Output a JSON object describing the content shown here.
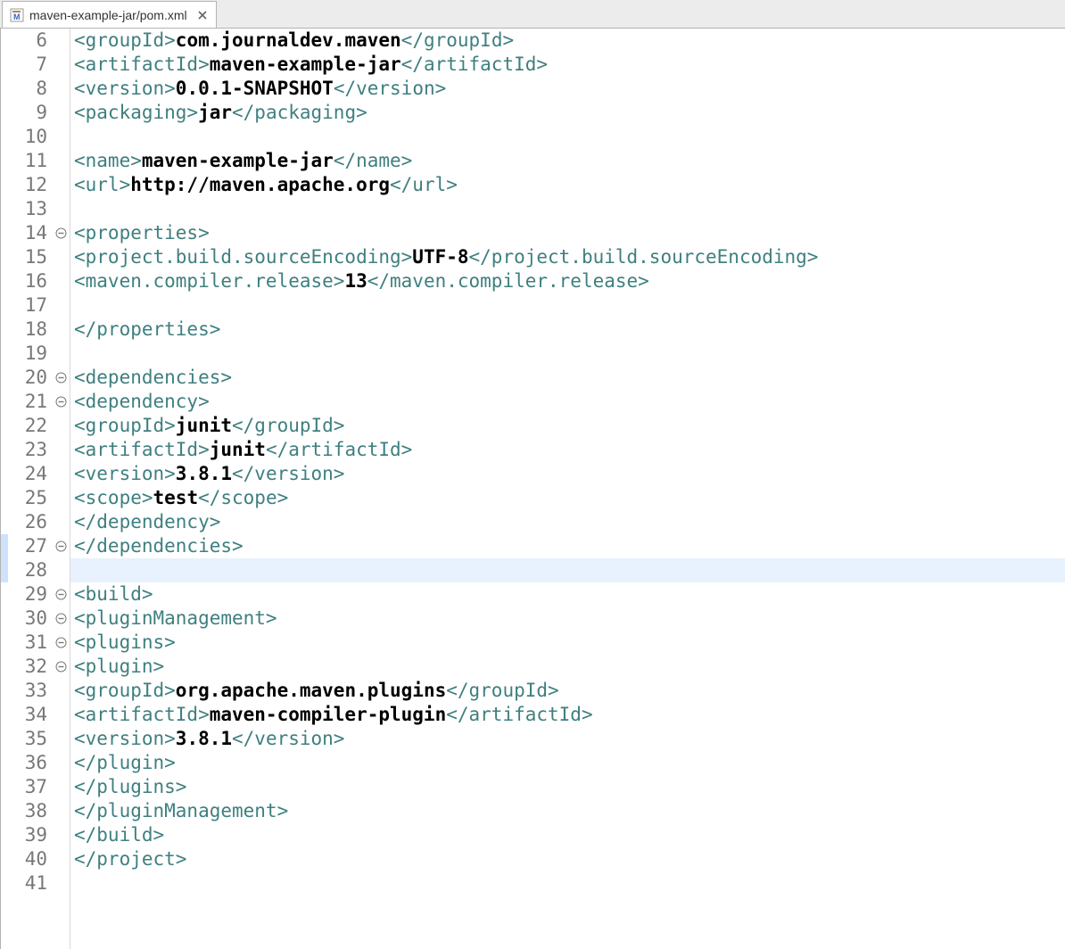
{
  "tab": {
    "title": "maven-example-jar/pom.xml"
  },
  "editor": {
    "highlighted_lines": [
      27,
      28
    ],
    "current_line": 28,
    "lines": [
      {
        "num": 6,
        "fold": "",
        "indent": 1,
        "segments": [
          [
            "tag",
            "<groupId>"
          ],
          [
            "txt",
            "com.journaldev.maven"
          ],
          [
            "tag",
            "</groupId>"
          ]
        ]
      },
      {
        "num": 7,
        "fold": "",
        "indent": 1,
        "segments": [
          [
            "tag",
            "<artifactId>"
          ],
          [
            "txt",
            "maven-example-jar"
          ],
          [
            "tag",
            "</artifactId>"
          ]
        ]
      },
      {
        "num": 8,
        "fold": "",
        "indent": 1,
        "segments": [
          [
            "tag",
            "<version>"
          ],
          [
            "txt",
            "0.0.1-SNAPSHOT"
          ],
          [
            "tag",
            "</version>"
          ]
        ]
      },
      {
        "num": 9,
        "fold": "",
        "indent": 1,
        "segments": [
          [
            "tag",
            "<packaging>"
          ],
          [
            "txt",
            "jar"
          ],
          [
            "tag",
            "</packaging>"
          ]
        ]
      },
      {
        "num": 10,
        "fold": "",
        "indent": 0,
        "segments": []
      },
      {
        "num": 11,
        "fold": "",
        "indent": 1,
        "segments": [
          [
            "tag",
            "<name>"
          ],
          [
            "txt",
            "maven-example-jar"
          ],
          [
            "tag",
            "</name>"
          ]
        ]
      },
      {
        "num": 12,
        "fold": "",
        "indent": 1,
        "segments": [
          [
            "tag",
            "<url>"
          ],
          [
            "txt",
            "http://maven.apache.org"
          ],
          [
            "tag",
            "</url>"
          ]
        ]
      },
      {
        "num": 13,
        "fold": "",
        "indent": 0,
        "segments": []
      },
      {
        "num": 14,
        "fold": "open",
        "indent": 1,
        "segments": [
          [
            "tag",
            "<properties>"
          ]
        ]
      },
      {
        "num": 15,
        "fold": "",
        "indent": 2,
        "segments": [
          [
            "tag",
            "<project.build.sourceEncoding>"
          ],
          [
            "txt",
            "UTF-8"
          ],
          [
            "tag",
            "</project.build.sourceEncoding>"
          ]
        ]
      },
      {
        "num": 16,
        "fold": "",
        "indent": 2,
        "segments": [
          [
            "tag",
            "<maven.compiler.release>"
          ],
          [
            "txt",
            "13"
          ],
          [
            "tag",
            "</maven.compiler.release>"
          ]
        ]
      },
      {
        "num": 17,
        "fold": "",
        "indent": 0,
        "segments": []
      },
      {
        "num": 18,
        "fold": "",
        "indent": 1,
        "segments": [
          [
            "tag",
            "</properties>"
          ]
        ]
      },
      {
        "num": 19,
        "fold": "",
        "indent": 0,
        "segments": []
      },
      {
        "num": 20,
        "fold": "open",
        "indent": 1,
        "segments": [
          [
            "tag",
            "<dependencies>"
          ]
        ]
      },
      {
        "num": 21,
        "fold": "open",
        "indent": 2,
        "segments": [
          [
            "tag",
            "<dependency>"
          ]
        ]
      },
      {
        "num": 22,
        "fold": "",
        "indent": 3,
        "segments": [
          [
            "tag",
            "<groupId>"
          ],
          [
            "txt",
            "junit"
          ],
          [
            "tag",
            "</groupId>"
          ]
        ]
      },
      {
        "num": 23,
        "fold": "",
        "indent": 3,
        "segments": [
          [
            "tag",
            "<artifactId>"
          ],
          [
            "txt",
            "junit"
          ],
          [
            "tag",
            "</artifactId>"
          ]
        ]
      },
      {
        "num": 24,
        "fold": "",
        "indent": 3,
        "segments": [
          [
            "tag",
            "<version>"
          ],
          [
            "txt",
            "3.8.1"
          ],
          [
            "tag",
            "</version>"
          ]
        ]
      },
      {
        "num": 25,
        "fold": "",
        "indent": 3,
        "segments": [
          [
            "tag",
            "<scope>"
          ],
          [
            "txt",
            "test"
          ],
          [
            "tag",
            "</scope>"
          ]
        ]
      },
      {
        "num": 26,
        "fold": "",
        "indent": 2,
        "segments": [
          [
            "tag",
            "</dependency>"
          ]
        ]
      },
      {
        "num": 27,
        "fold": "open",
        "indent": 1,
        "segments": [
          [
            "tag",
            "</dependencies>"
          ]
        ]
      },
      {
        "num": 28,
        "fold": "",
        "indent": 0,
        "segments": []
      },
      {
        "num": 29,
        "fold": "open",
        "indent": 1,
        "segments": [
          [
            "tag",
            "<build>"
          ]
        ]
      },
      {
        "num": 30,
        "fold": "open",
        "indent": 2,
        "segments": [
          [
            "tag",
            "<pluginManagement>"
          ]
        ]
      },
      {
        "num": 31,
        "fold": "open",
        "indent": 3,
        "segments": [
          [
            "tag",
            "<plugins>"
          ]
        ]
      },
      {
        "num": 32,
        "fold": "open",
        "indent": 4,
        "segments": [
          [
            "tag",
            "<plugin>"
          ]
        ]
      },
      {
        "num": 33,
        "fold": "",
        "indent": 5,
        "segments": [
          [
            "tag",
            "<groupId>"
          ],
          [
            "txt",
            "org.apache.maven.plugins"
          ],
          [
            "tag",
            "</groupId>"
          ]
        ]
      },
      {
        "num": 34,
        "fold": "",
        "indent": 5,
        "segments": [
          [
            "tag",
            "<artifactId>"
          ],
          [
            "txt",
            "maven-compiler-plugin"
          ],
          [
            "tag",
            "</artifactId>"
          ]
        ]
      },
      {
        "num": 35,
        "fold": "",
        "indent": 5,
        "segments": [
          [
            "tag",
            "<version>"
          ],
          [
            "txt",
            "3.8.1"
          ],
          [
            "tag",
            "</version>"
          ]
        ]
      },
      {
        "num": 36,
        "fold": "",
        "indent": 4,
        "segments": [
          [
            "tag",
            "</plugin>"
          ]
        ]
      },
      {
        "num": 37,
        "fold": "",
        "indent": 3,
        "segments": [
          [
            "tag",
            "</plugins>"
          ]
        ]
      },
      {
        "num": 38,
        "fold": "",
        "indent": 2,
        "segments": [
          [
            "tag",
            "</pluginManagement>"
          ]
        ]
      },
      {
        "num": 39,
        "fold": "",
        "indent": 1,
        "segments": [
          [
            "tag",
            "</build>"
          ]
        ]
      },
      {
        "num": 40,
        "fold": "",
        "indent": 0,
        "segments": [
          [
            "tag",
            "</project>"
          ]
        ]
      },
      {
        "num": 41,
        "fold": "",
        "indent": 0,
        "segments": []
      }
    ]
  }
}
